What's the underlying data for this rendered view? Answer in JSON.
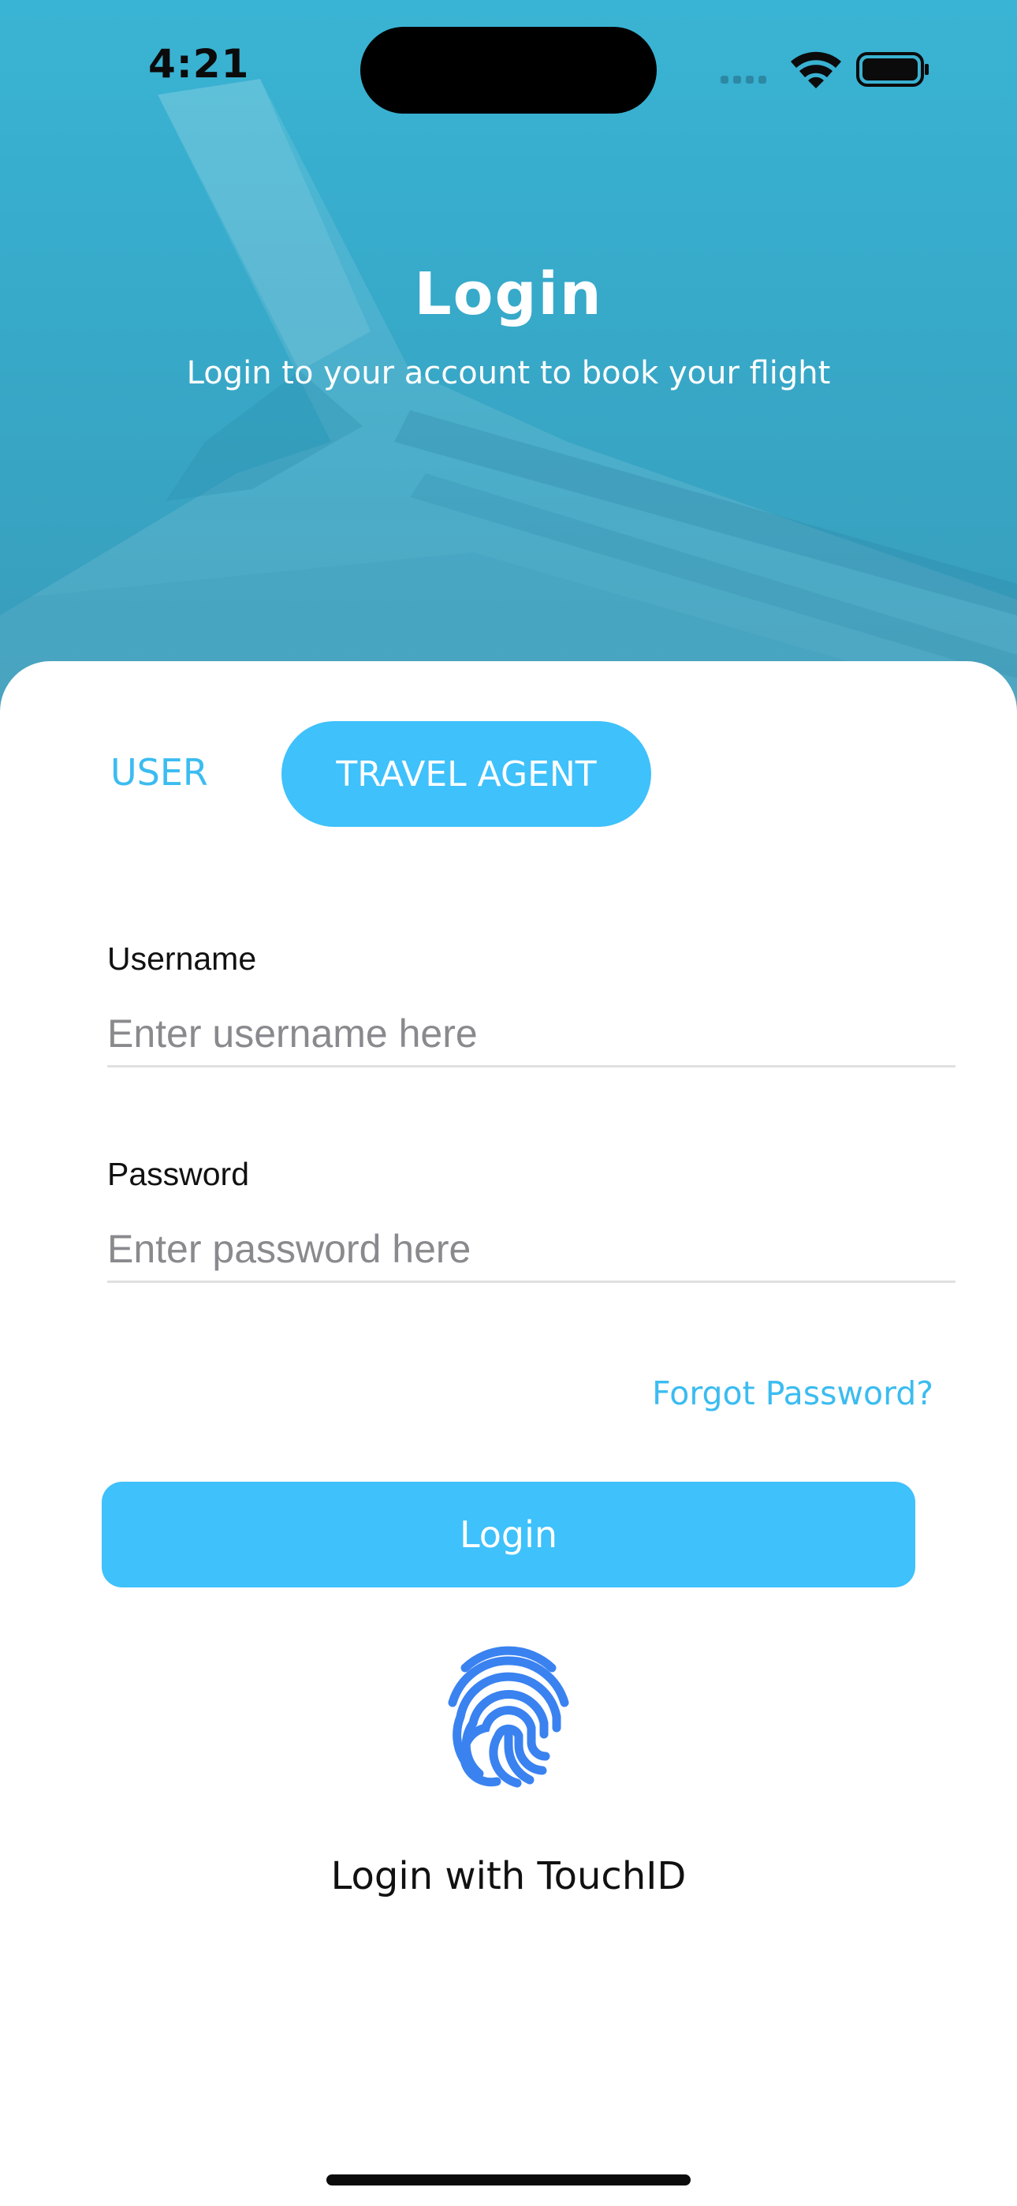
{
  "status_bar": {
    "time": "4:21"
  },
  "header": {
    "title": "Login",
    "subtitle": "Login to your account to book your flight"
  },
  "tabs": {
    "user_label": "USER",
    "agent_label": "TRAVEL AGENT",
    "selected": "TRAVEL AGENT"
  },
  "form": {
    "username_label": "Username",
    "username_placeholder": "Enter username here",
    "username_value": "",
    "password_label": "Password",
    "password_placeholder": "Enter password here",
    "password_value": "",
    "forgot_label": "Forgot Password?"
  },
  "actions": {
    "login_label": "Login",
    "touchid_label": "Login with TouchID"
  },
  "icons": {
    "fingerprint": "fingerprint-icon",
    "wifi": "wifi-icon",
    "battery": "battery-icon",
    "signal": "cellular-signal-icon"
  },
  "colors": {
    "accent": "#3fc1fb",
    "accent_text": "#3bbcf0",
    "hero_top": "#3ab4d4",
    "fingerprint": "#3a82f0"
  }
}
